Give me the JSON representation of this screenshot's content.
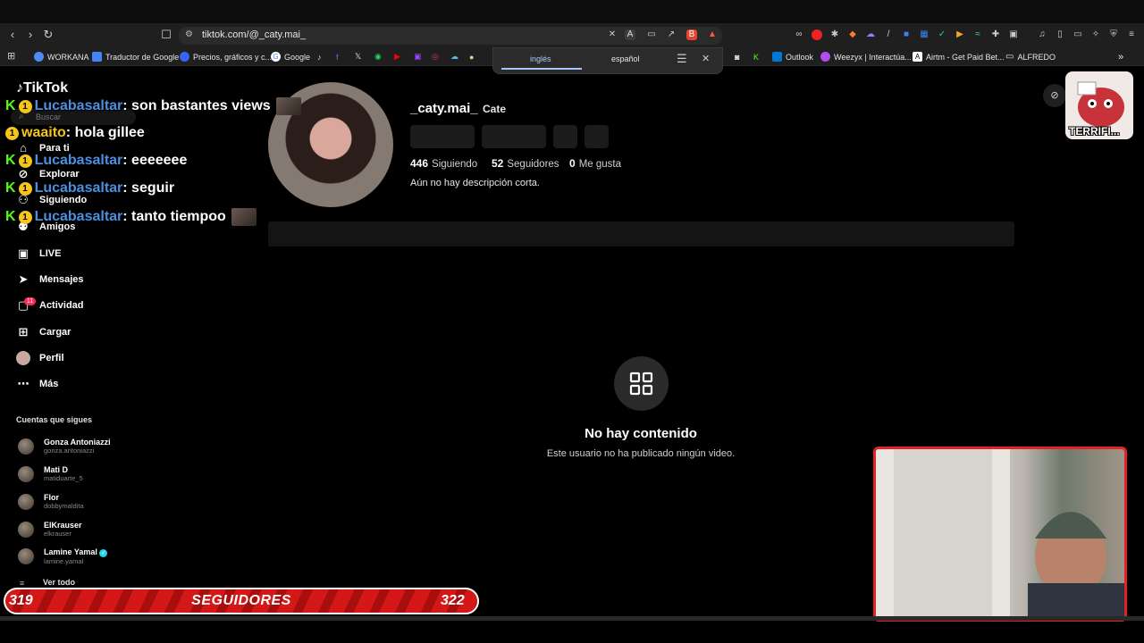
{
  "browser": {
    "url": "tiktok.com/@_caty.mai_",
    "bookmarks": [
      "WORKANA",
      "Traductor de Google",
      "Precios, gráficos y c...",
      "Google",
      "Outlook",
      "Weezyx | Interactúa...",
      "Airtm - Get Paid Bet...",
      "ALFREDO"
    ],
    "translate": {
      "lang_source": "inglés",
      "lang_target": "español"
    }
  },
  "sidebar": {
    "logo": "TikTok",
    "search_placeholder": "Buscar",
    "nav": [
      "Para ti",
      "Explorar",
      "Siguiendo",
      "Amigos",
      "LIVE",
      "Mensajes",
      "Actividad",
      "Cargar",
      "Perfil",
      "Más"
    ],
    "activity_badge": "11",
    "following_heading": "Cuentas que sigues",
    "accounts": [
      {
        "name": "Gonza Antoniazzi",
        "handle": "gonza.antoniazzi"
      },
      {
        "name": "Mati D",
        "handle": "matiduarte_5"
      },
      {
        "name": "Flor",
        "handle": "dobbymaldita"
      },
      {
        "name": "ElKrauser",
        "handle": "elkrauser"
      },
      {
        "name": "Lamine Yamal",
        "handle": "lamine.yamal",
        "verified": true
      }
    ],
    "see_all": "Ver todo"
  },
  "chat": [
    {
      "badge": "K",
      "level": "1",
      "user": "Lucabasaltar",
      "msg": ": son bastantes views"
    },
    {
      "badge": "",
      "level": "1",
      "user": "waaito",
      "msg": ": hola gillee"
    },
    {
      "badge": "K",
      "level": "1",
      "user": "Lucabasaltar",
      "msg": ": eeeeeee"
    },
    {
      "badge": "K",
      "level": "1",
      "user": "Lucabasaltar",
      "msg": ": seguir"
    },
    {
      "badge": "K",
      "level": "1",
      "user": "Lucabasaltar",
      "msg": ": tanto tiempoo"
    }
  ],
  "profile": {
    "username": "_caty.mai_",
    "nickname": "Cate",
    "following_count": "446",
    "following_label": "Siguiendo",
    "followers_count": "52",
    "followers_label": "Seguidores",
    "likes_count": "0",
    "likes_label": "Me gusta",
    "bio": "Aún no hay descripción corta.",
    "empty_title": "No hay contenido",
    "empty_subtitle": "Este usuario no ha publicado ningún video."
  },
  "overlay": {
    "alert_text": "TERRIFI...",
    "followers_current": "319",
    "followers_label": "SEGUIDORES",
    "followers_goal": "322"
  }
}
